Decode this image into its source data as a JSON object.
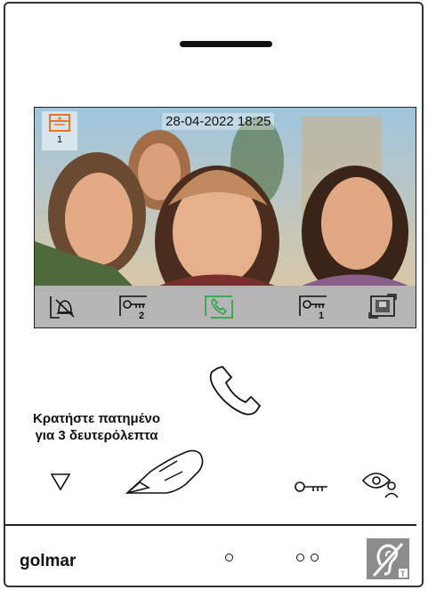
{
  "screen": {
    "datetime": "28-04-2022 18:25",
    "camera_number": "1",
    "icons": [
      "bell-off-icon",
      "lock-2-icon",
      "answer-call-icon",
      "lock-1-icon",
      "camera-switch-icon"
    ],
    "lock2_label": "2",
    "lock1_label": "1",
    "accent_orange": "#e8732a",
    "accent_green": "#2aa84a"
  },
  "hint": {
    "line1": "Κρατήστε πατημένο",
    "line2": "για 3 δευτερόλεπτα"
  },
  "buttons": [
    "menu-down-button",
    "call-button",
    "key-button",
    "auto-start-button"
  ],
  "brand": "golmar",
  "leds": [
    "led-single",
    "led-double"
  ],
  "hearing_aid_icon": "hearing-loop-icon"
}
